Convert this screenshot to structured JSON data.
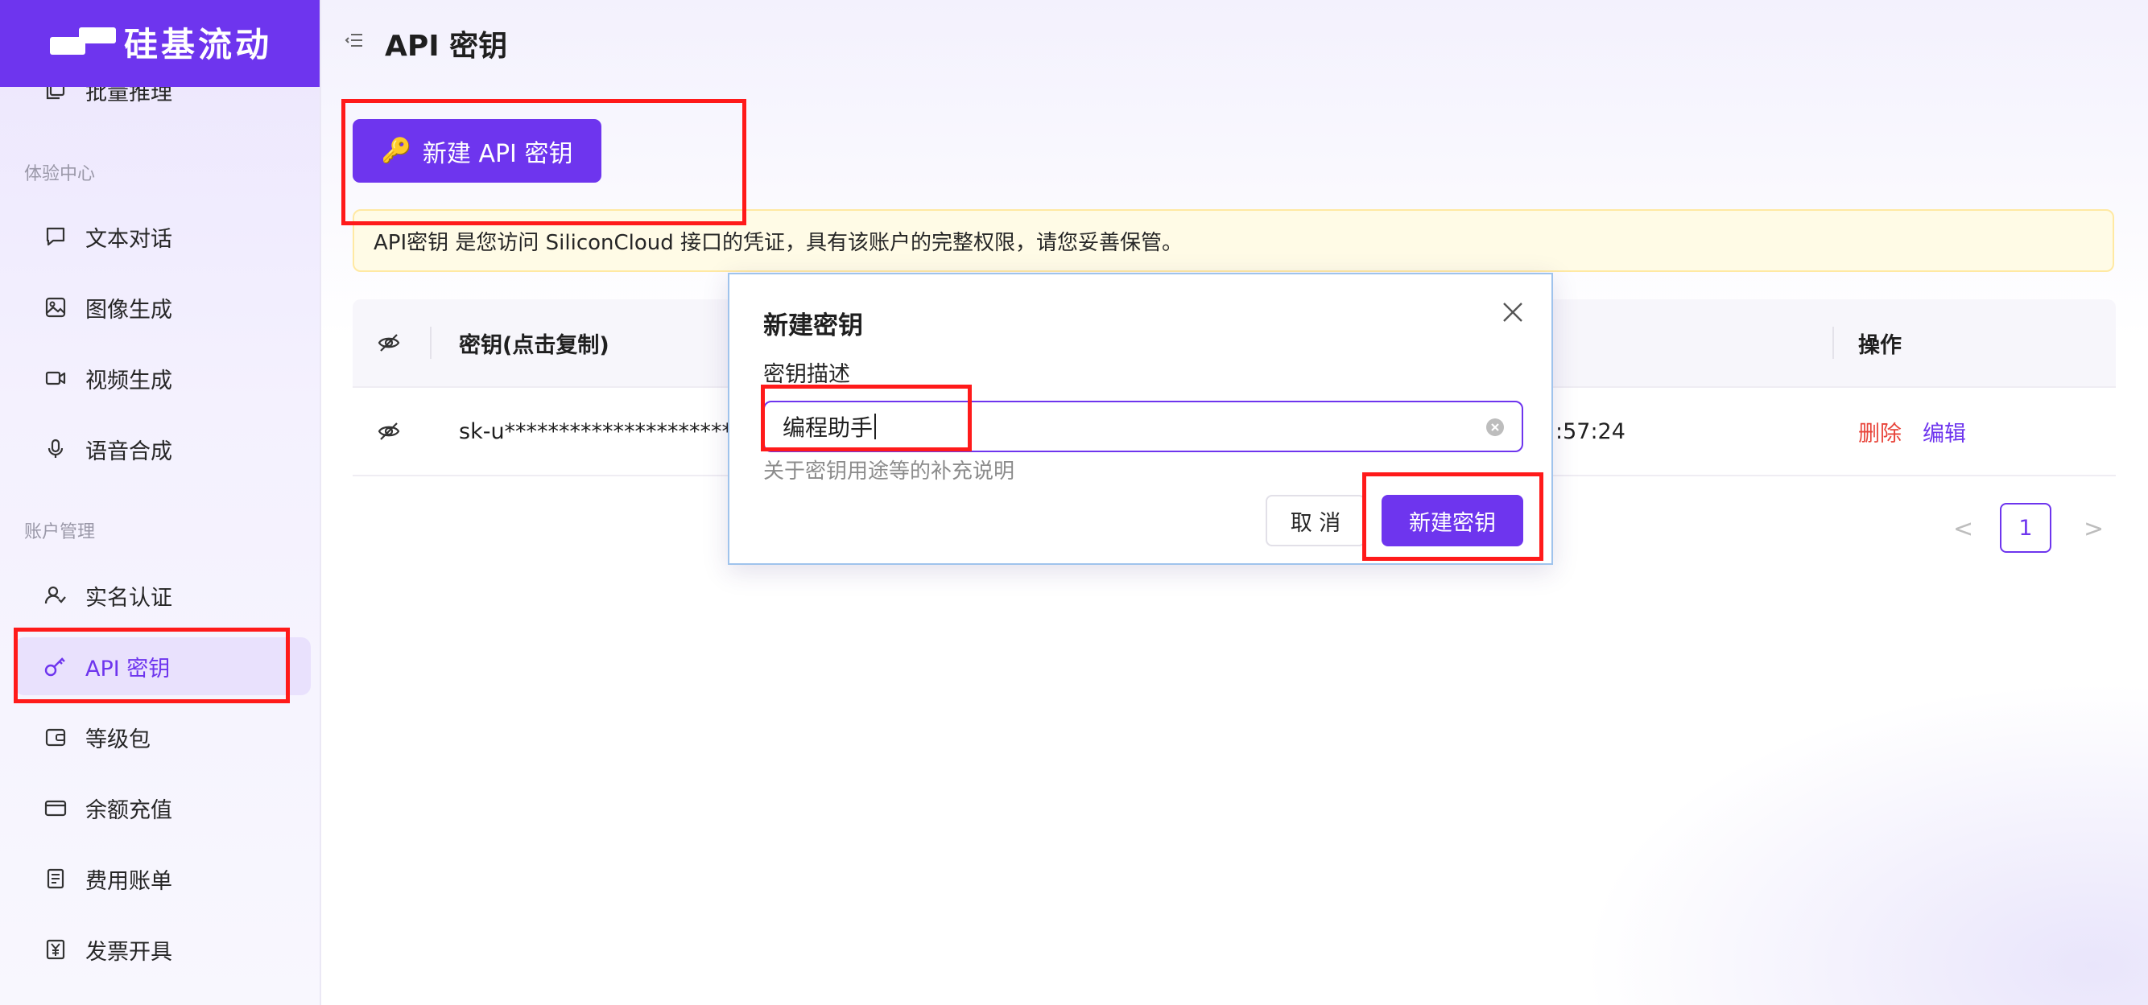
{
  "brand": {
    "name": "硅基流动",
    "primary": "#6e35ee"
  },
  "page": {
    "title": "API 密钥"
  },
  "sidebar": {
    "partial_item": "批量推理",
    "group_experience": "体验中心",
    "experience_items": [
      {
        "label": "文本对话",
        "icon": "chat-icon"
      },
      {
        "label": "图像生成",
        "icon": "image-icon"
      },
      {
        "label": "视频生成",
        "icon": "video-icon"
      },
      {
        "label": "语音合成",
        "icon": "microphone-icon"
      }
    ],
    "group_account": "账户管理",
    "account_items": [
      {
        "label": "实名认证",
        "icon": "user-check-icon"
      },
      {
        "label": "API 密钥",
        "icon": "key-icon",
        "active": true
      },
      {
        "label": "等级包",
        "icon": "wallet-icon"
      },
      {
        "label": "余额充值",
        "icon": "credit-card-icon"
      },
      {
        "label": "费用账单",
        "icon": "bill-icon"
      },
      {
        "label": "发票开具",
        "icon": "yen-icon"
      }
    ]
  },
  "toolbar": {
    "new_key_label": "新建 API 密钥"
  },
  "notice": {
    "text": "API密钥 是您访问 SiliconCloud 接口的凭证，具有该账户的完整权限，请您妥善保管。"
  },
  "table": {
    "columns": {
      "key": "密钥(点击复制)",
      "actions": "操作"
    },
    "rows": [
      {
        "key": "sk-u**************************",
        "created_partial": ":57:24",
        "delete": "删除",
        "edit": "编辑"
      }
    ]
  },
  "pagination": {
    "current": "1",
    "prev": "<",
    "next": ">"
  },
  "modal": {
    "title": "新建密钥",
    "field_label": "密钥描述",
    "field_value": "编程助手",
    "field_help": "关于密钥用途等的补充说明",
    "cancel": "取 消",
    "submit": "新建密钥"
  },
  "highlight_color": "#ff1a1a"
}
